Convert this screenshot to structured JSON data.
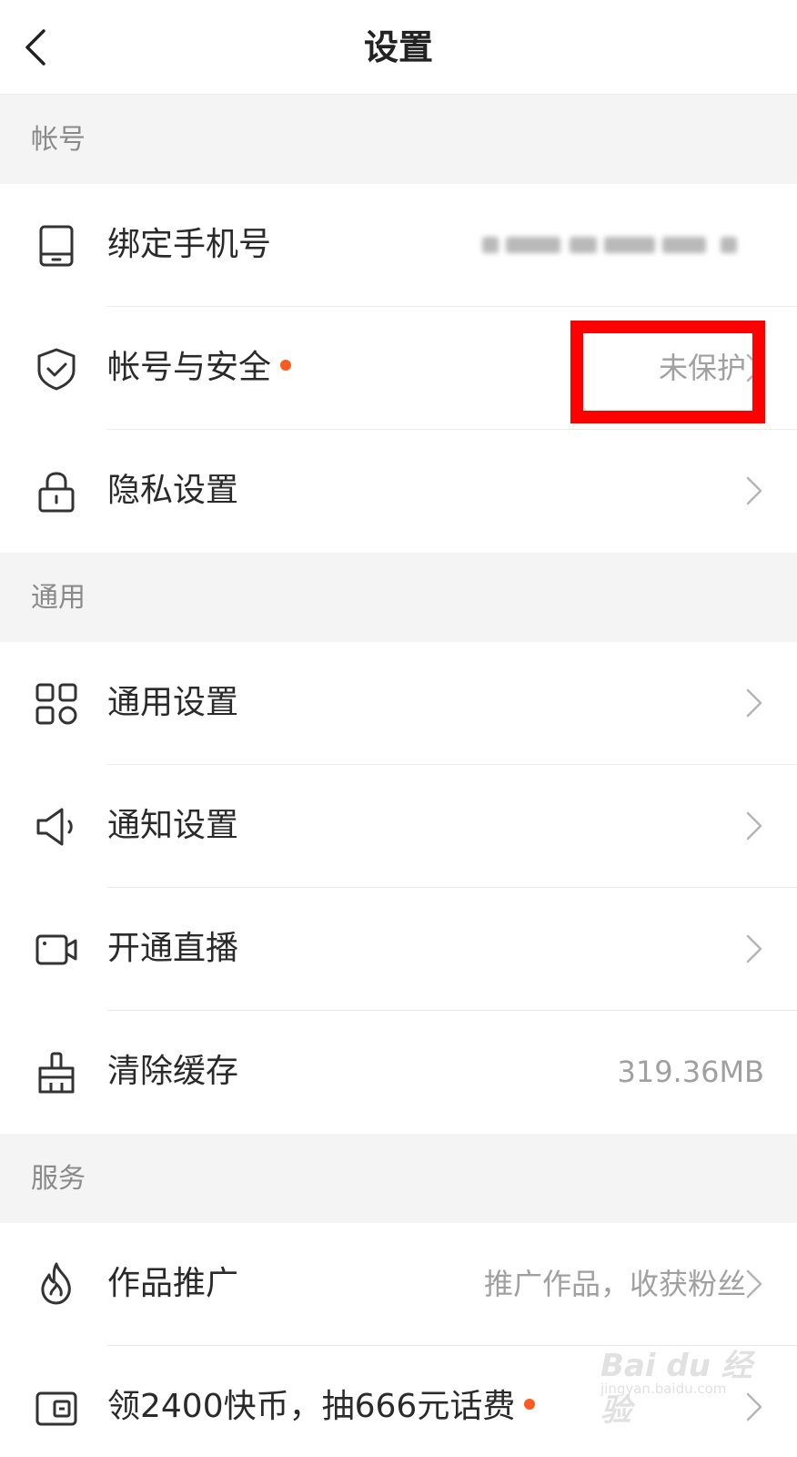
{
  "header": {
    "title": "设置",
    "back_icon": "back-arrow-icon"
  },
  "sections": {
    "account": "帐号",
    "general": "通用",
    "service": "服务"
  },
  "rows": {
    "bind_phone": {
      "label": "绑定手机号",
      "icon": "phone-icon"
    },
    "account_security": {
      "label": "帐号与安全",
      "value": "未保护",
      "icon": "shield-check-icon"
    },
    "privacy": {
      "label": "隐私设置",
      "icon": "lock-icon"
    },
    "general_settings": {
      "label": "通用设置",
      "icon": "grid-icon"
    },
    "notification": {
      "label": "通知设置",
      "icon": "speaker-icon"
    },
    "live": {
      "label": "开通直播",
      "icon": "video-camera-icon"
    },
    "clear_cache": {
      "label": "清除缓存",
      "value": "319.36MB",
      "icon": "broom-icon"
    },
    "promotion": {
      "label": "作品推广",
      "value": "推广作品，收获粉丝",
      "icon": "flame-icon"
    },
    "coins": {
      "label": "领2400快币，抽666元话费",
      "icon": "wallet-icon"
    }
  },
  "watermark": {
    "logo": "Bai du 经验",
    "url": "jingyan.baidu.com"
  },
  "colors": {
    "accent_dot": "#ff5a1f",
    "highlight_box": "#ff0000",
    "section_bg": "#f4f4f4"
  }
}
